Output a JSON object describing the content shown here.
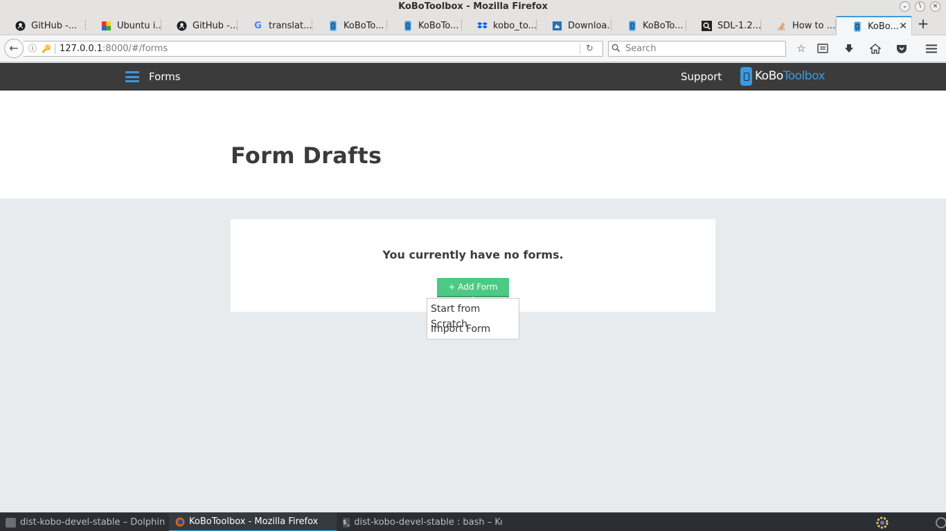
{
  "window": {
    "title": "KoBoToolbox - Mozilla Firefox"
  },
  "tabs": [
    {
      "label": "GitHub -...",
      "icon": "github-icon"
    },
    {
      "label": "Ubuntu i...",
      "icon": "ubuntu-icon"
    },
    {
      "label": "GitHub -...",
      "icon": "github-icon"
    },
    {
      "label": "translat...",
      "icon": "google-icon"
    },
    {
      "label": "KoBoTo...",
      "icon": "kobo-icon"
    },
    {
      "label": "KoBoTo...",
      "icon": "kobo-icon"
    },
    {
      "label": "kobo_to...",
      "icon": "dropbox-icon"
    },
    {
      "label": "Downloa...",
      "icon": "download-site-icon"
    },
    {
      "label": "KoBoTo...",
      "icon": "kobo-icon"
    },
    {
      "label": "SDL-1.2....",
      "icon": "search-site-icon"
    },
    {
      "label": "How to ...",
      "icon": "stackoverflow-icon"
    },
    {
      "label": "KoBo...",
      "icon": "kobo-icon",
      "active": true
    }
  ],
  "navbar": {
    "url_host": "127.0.0.1",
    "url_rest": ":8000/#/forms",
    "search_placeholder": "Search"
  },
  "app": {
    "nav_title": "Forms",
    "support_label": "Support",
    "logo_word1": "KoBo",
    "logo_word2": "Toolbox",
    "brand_color": "#3a9ae1"
  },
  "page": {
    "title": "Form Drafts",
    "empty_message": "You currently have no forms.",
    "add_button_label": "+ Add Form",
    "add_button_color": "#4cc983",
    "dropdown": [
      {
        "label": "Start from Scratch"
      },
      {
        "label": "Import Form"
      }
    ]
  },
  "taskbar": {
    "tasks": [
      {
        "label": "dist-kobo-devel-stable – Dolphin"
      },
      {
        "label": "KoBoToolbox - Mozilla Firefox"
      },
      {
        "label": "dist-kobo-devel-stable : bash – Ko"
      }
    ]
  }
}
